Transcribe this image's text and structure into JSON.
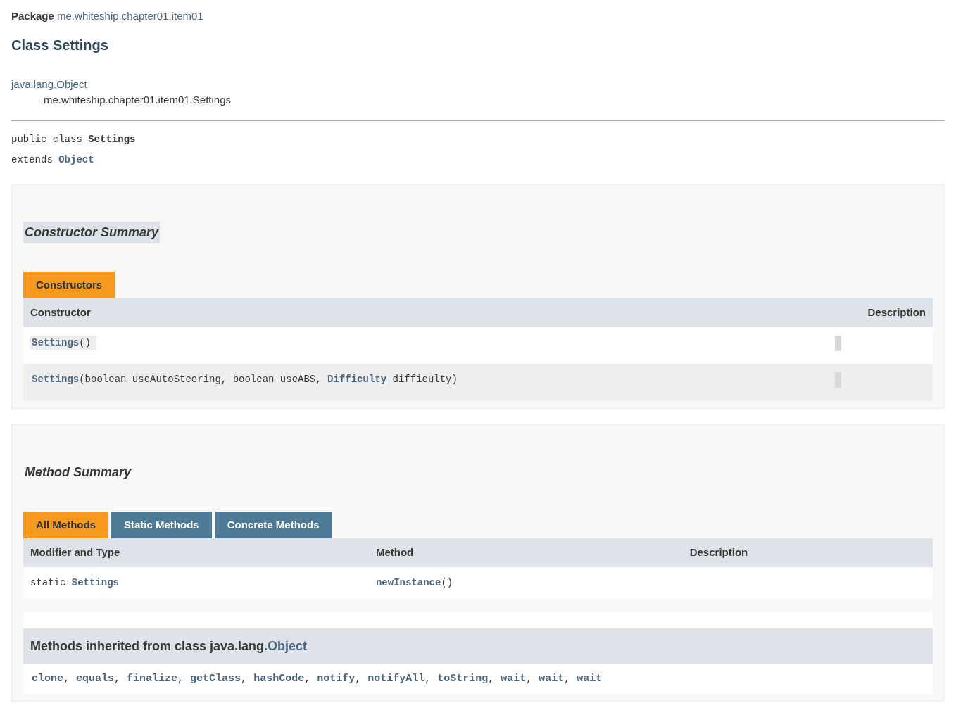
{
  "header": {
    "package_label": "Package",
    "package_name": "me.whiteship.chapter01.item01",
    "title": "Class Settings"
  },
  "inheritance": [
    {
      "text": "java.lang.Object",
      "kind": "link"
    },
    {
      "text": "me.whiteship.chapter01.item01.Settings",
      "kind": "text"
    }
  ],
  "declaration": {
    "line_1": [
      {
        "text": "public class ",
        "kind": "text"
      },
      {
        "text": "Settings",
        "kind": "bold"
      }
    ],
    "line_2": [
      {
        "text": "extends ",
        "kind": "text"
      },
      {
        "text": "Object",
        "kind": "link"
      }
    ]
  },
  "constructor_summary": {
    "title": "Constructor Summary",
    "tabs": [
      {
        "label": "Constructors",
        "selected": true
      }
    ],
    "columns": [
      "Constructor",
      "Description"
    ],
    "rows": [
      {
        "signature": [
          {
            "text": "Settings",
            "kind": "link"
          },
          {
            "text": "()",
            "kind": "text"
          }
        ]
      },
      {
        "signature": [
          {
            "text": "Settings",
            "kind": "link"
          },
          {
            "text": "(boolean useAutoSteering, boolean useABS, ",
            "kind": "text"
          },
          {
            "text": "Difficulty",
            "kind": "link"
          },
          {
            "text": " difficulty)",
            "kind": "text"
          }
        ]
      }
    ]
  },
  "method_summary": {
    "title": "Method Summary",
    "tabs": [
      {
        "label": "All Methods",
        "selected": true
      },
      {
        "label": "Static Methods",
        "selected": false
      },
      {
        "label": "Concrete Methods",
        "selected": false
      }
    ],
    "columns": [
      "Modifier and Type",
      "Method",
      "Description"
    ],
    "rows": [
      {
        "type": [
          {
            "text": "static ",
            "kind": "text"
          },
          {
            "text": "Settings",
            "kind": "link"
          }
        ],
        "method": [
          {
            "text": "newInstance",
            "kind": "link"
          },
          {
            "text": "()",
            "kind": "text"
          }
        ]
      }
    ],
    "inherited": {
      "heading": [
        {
          "text": "Methods inherited from class java.lang.",
          "kind": "text"
        },
        {
          "text": "Object",
          "kind": "link"
        }
      ],
      "separator": ", ",
      "methods": [
        "clone",
        "equals",
        "finalize",
        "getClass",
        "hashCode",
        "notify",
        "notifyAll",
        "toString",
        "wait",
        "wait",
        "wait"
      ]
    }
  }
}
